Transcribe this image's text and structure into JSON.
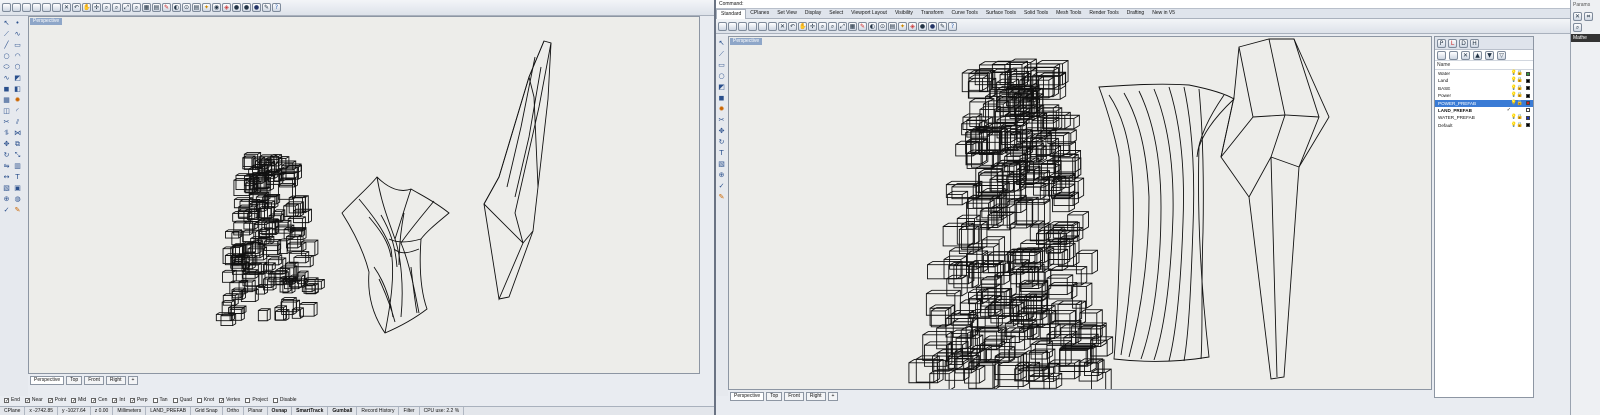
{
  "left": {
    "viewport_label": "Perspective",
    "view_tabs": [
      "Perspective",
      "Top",
      "Front",
      "Right"
    ],
    "osnaps": [
      {
        "label": "End",
        "checked": true
      },
      {
        "label": "Near",
        "checked": true
      },
      {
        "label": "Point",
        "checked": true
      },
      {
        "label": "Mid",
        "checked": true
      },
      {
        "label": "Cen",
        "checked": true
      },
      {
        "label": "Int",
        "checked": true
      },
      {
        "label": "Perp",
        "checked": true
      },
      {
        "label": "Tan",
        "checked": false
      },
      {
        "label": "Quad",
        "checked": false
      },
      {
        "label": "Knot",
        "checked": false
      },
      {
        "label": "Vertex",
        "checked": true
      },
      {
        "label": "Project",
        "checked": false
      },
      {
        "label": "Disable",
        "checked": false
      }
    ],
    "status": {
      "cplane": "CPlane",
      "x": "x -2742.85",
      "y": "y -1027.64",
      "z": "z 0.00",
      "units": "Millimeters",
      "layer": "LAND_PREFAB",
      "modes": [
        "Grid Snap",
        "Ortho",
        "Planar",
        "Osnap",
        "SmartTrack",
        "Gumball",
        "Record History",
        "Filter"
      ],
      "cpu": "CPU use: 2.2 %"
    }
  },
  "right": {
    "command_label": "Command:",
    "toolbar_tabs": [
      "Standard",
      "CPlanes",
      "Set View",
      "Display",
      "Select",
      "Viewport Layout",
      "Visibility",
      "Transform",
      "Curve Tools",
      "Surface Tools",
      "Solid Tools",
      "Mesh Tools",
      "Render Tools",
      "Drafting",
      "New in V5"
    ],
    "viewport_label": "Perspective",
    "view_tabs": [
      "Perspective",
      "Top",
      "Front",
      "Right"
    ],
    "layers_header": "Name",
    "layers": [
      {
        "name": "Water",
        "color": "#2f9e3a"
      },
      {
        "name": "Land",
        "color": "#000000"
      },
      {
        "name": "BASE",
        "color": "#000000"
      },
      {
        "name": "Power",
        "color": "#000000"
      },
      {
        "name": "POWER_PREFAB",
        "color": "#d32020",
        "selected": true
      },
      {
        "name": "LAND_PREFAB",
        "color": "#ffffff",
        "current": true
      },
      {
        "name": "WATER_PREFAB",
        "color": "#1a2fb8"
      },
      {
        "name": "Default",
        "color": "#000000"
      }
    ]
  },
  "side_panel": {
    "label_1": "Params",
    "label_2": "Mathe"
  },
  "colors": {
    "viewport_bg": "#ededea",
    "selection": "#3a7bd5",
    "viewport_label_bg": "#8ea6c8"
  }
}
